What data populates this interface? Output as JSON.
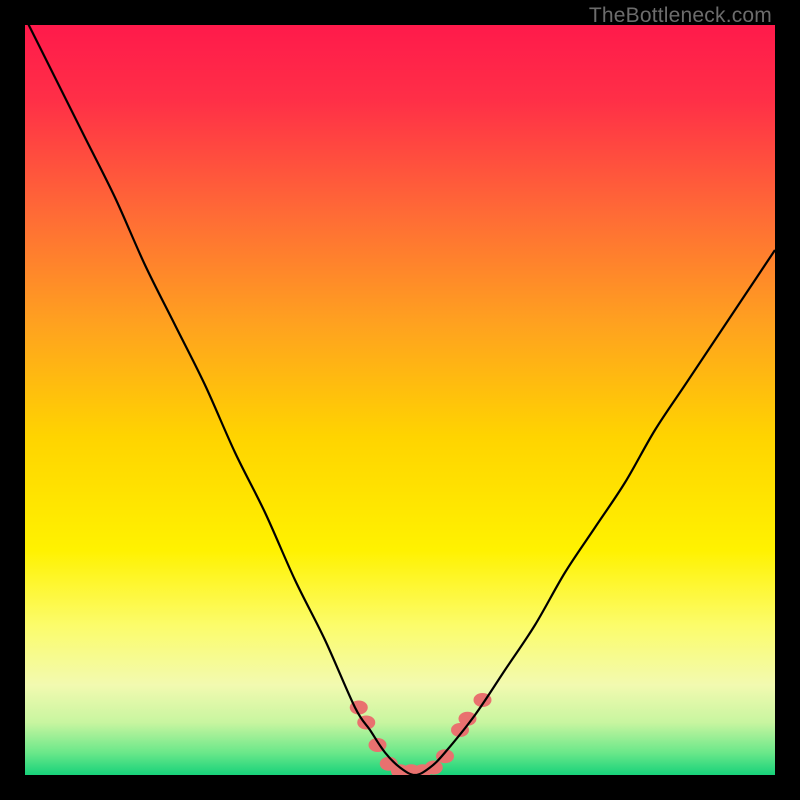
{
  "watermark": "TheBottleneck.com",
  "chart_data": {
    "type": "line",
    "title": "",
    "xlabel": "",
    "ylabel": "",
    "xlim": [
      0,
      100
    ],
    "ylim": [
      0,
      100
    ],
    "series": [
      {
        "name": "bottleneck-curve",
        "x": [
          0,
          4,
          8,
          12,
          16,
          20,
          24,
          28,
          32,
          36,
          40,
          44,
          46,
          48,
          50,
          52,
          54,
          56,
          60,
          64,
          68,
          72,
          76,
          80,
          84,
          88,
          92,
          96,
          100
        ],
        "y": [
          101,
          93,
          85,
          77,
          68,
          60,
          52,
          43,
          35,
          26,
          18,
          9,
          6,
          3,
          1,
          0,
          1,
          3,
          8,
          14,
          20,
          27,
          33,
          39,
          46,
          52,
          58,
          64,
          70
        ]
      }
    ],
    "markers": {
      "name": "highlight-dots",
      "points": [
        {
          "x": 44.5,
          "y": 9
        },
        {
          "x": 45.5,
          "y": 7
        },
        {
          "x": 47,
          "y": 4
        },
        {
          "x": 48.5,
          "y": 1.5
        },
        {
          "x": 50,
          "y": 0.5
        },
        {
          "x": 51.5,
          "y": 0.5
        },
        {
          "x": 53,
          "y": 0.5
        },
        {
          "x": 54.5,
          "y": 1
        },
        {
          "x": 56,
          "y": 2.5
        },
        {
          "x": 58,
          "y": 6
        },
        {
          "x": 59,
          "y": 7.5
        },
        {
          "x": 61,
          "y": 10
        }
      ]
    },
    "gradient_stops": [
      {
        "offset": 0.0,
        "color": "#ff1a4b"
      },
      {
        "offset": 0.1,
        "color": "#ff2f47"
      },
      {
        "offset": 0.25,
        "color": "#ff6a36"
      },
      {
        "offset": 0.4,
        "color": "#ffa21f"
      },
      {
        "offset": 0.55,
        "color": "#ffd400"
      },
      {
        "offset": 0.7,
        "color": "#fff200"
      },
      {
        "offset": 0.8,
        "color": "#fcfc6a"
      },
      {
        "offset": 0.88,
        "color": "#f2fab0"
      },
      {
        "offset": 0.93,
        "color": "#c8f5a0"
      },
      {
        "offset": 0.97,
        "color": "#6be88a"
      },
      {
        "offset": 1.0,
        "color": "#17d27a"
      }
    ],
    "marker_style": {
      "fill": "#e9716f",
      "rx": 9,
      "ry": 7
    },
    "stroke": "#000000"
  }
}
